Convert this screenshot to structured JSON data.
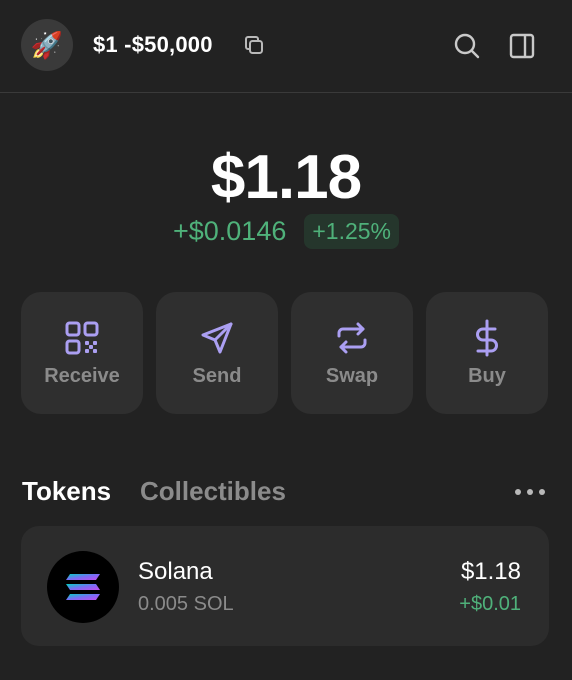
{
  "header": {
    "account_name": "$1 -$50,000",
    "avatar_emoji": "🚀",
    "icons": [
      "rocket-icon",
      "copy-icon",
      "search-icon",
      "side-panel-icon"
    ]
  },
  "balance": {
    "total": "$1.18",
    "change_abs": "+$0.0146",
    "change_pct": "+1.25%"
  },
  "actions": [
    {
      "label": "Receive",
      "icon": "qr-code-icon"
    },
    {
      "label": "Send",
      "icon": "send-icon"
    },
    {
      "label": "Swap",
      "icon": "swap-icon"
    },
    {
      "label": "Buy",
      "icon": "dollar-icon"
    }
  ],
  "tabs": {
    "tokens": "Tokens",
    "collectibles": "Collectibles"
  },
  "tokens": [
    {
      "name": "Solana",
      "amount": "0.005 SOL",
      "value": "$1.18",
      "change": "+$0.01",
      "icon": "solana-logo-icon"
    }
  ],
  "colors": {
    "background": "#222222",
    "card": "#2f2f2f",
    "accent": "#ab9ff2",
    "positive": "#4fb17a",
    "muted": "#8b8b8b"
  }
}
